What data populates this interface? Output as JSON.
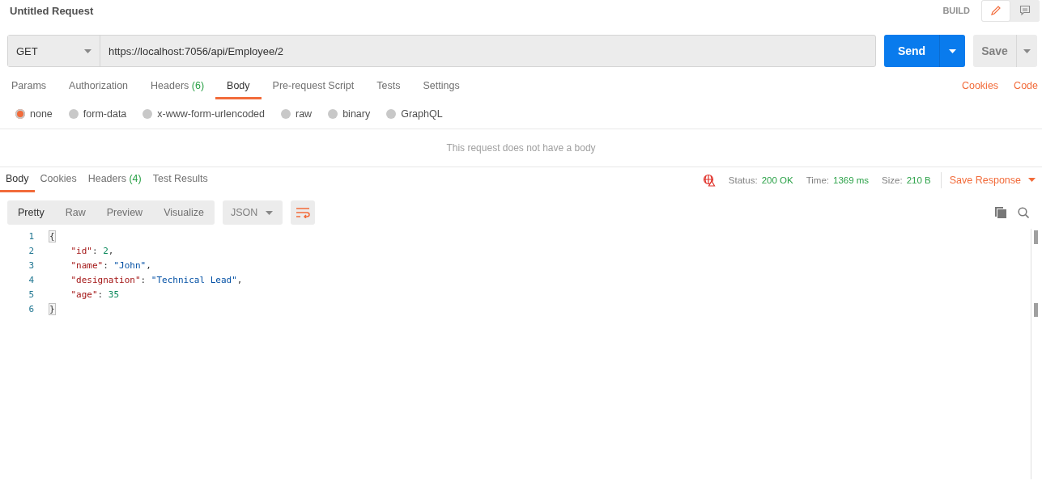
{
  "header": {
    "title": "Untitled Request",
    "mode": "BUILD",
    "mode_buttons": [
      {
        "kind": "edit",
        "selected": true
      },
      {
        "kind": "comments",
        "selected": false
      }
    ]
  },
  "request": {
    "method": "GET",
    "url": "https://localhost:7056/api/Employee/2",
    "send": "Send",
    "save": "Save"
  },
  "request_tabs": [
    {
      "label": "Params",
      "selected": false
    },
    {
      "label": "Authorization",
      "selected": false
    },
    {
      "label": "Headers",
      "count": "(6)",
      "selected": false
    },
    {
      "label": "Body",
      "selected": true
    },
    {
      "label": "Pre-request Script",
      "selected": false
    },
    {
      "label": "Tests",
      "selected": false
    },
    {
      "label": "Settings",
      "selected": false
    }
  ],
  "request_links": [
    "Cookies",
    "Code"
  ],
  "body_types": [
    {
      "label": "none",
      "selected": true
    },
    {
      "label": "form-data",
      "selected": false
    },
    {
      "label": "x-www-form-urlencoded",
      "selected": false
    },
    {
      "label": "raw",
      "selected": false
    },
    {
      "label": "binary",
      "selected": false
    },
    {
      "label": "GraphQL",
      "selected": false
    }
  ],
  "body_message": "This request does not have a body",
  "response_tabs": [
    {
      "label": "Body",
      "selected": true
    },
    {
      "label": "Cookies",
      "selected": false
    },
    {
      "label": "Headers",
      "count": "(4)",
      "selected": false
    },
    {
      "label": "Test Results",
      "selected": false
    }
  ],
  "response_meta": [
    {
      "label": "Status:",
      "value": "200 OK"
    },
    {
      "label": "Time:",
      "value": "1369 ms"
    },
    {
      "label": "Size:",
      "value": "210 B"
    }
  ],
  "save_response": "Save Response",
  "view_modes": [
    {
      "label": "Pretty",
      "selected": true
    },
    {
      "label": "Raw",
      "selected": false
    },
    {
      "label": "Preview",
      "selected": false
    },
    {
      "label": "Visualize",
      "selected": false
    }
  ],
  "format": "JSON",
  "code_lines": [
    {
      "number": "1",
      "tokens": [
        {
          "kind": "bracket",
          "text": "{"
        }
      ]
    },
    {
      "number": "2",
      "tokens": [
        {
          "kind": "key",
          "text": "    \"id\""
        },
        {
          "kind": "punct",
          "text": ": "
        },
        {
          "kind": "number",
          "text": "2"
        },
        {
          "kind": "punct",
          "text": ","
        }
      ]
    },
    {
      "number": "3",
      "tokens": [
        {
          "kind": "key",
          "text": "    \"name\""
        },
        {
          "kind": "punct",
          "text": ": "
        },
        {
          "kind": "string",
          "text": "\"John\""
        },
        {
          "kind": "punct",
          "text": ","
        }
      ]
    },
    {
      "number": "4",
      "tokens": [
        {
          "kind": "key",
          "text": "    \"designation\""
        },
        {
          "kind": "punct",
          "text": ": "
        },
        {
          "kind": "string",
          "text": "\"Technical Lead\""
        },
        {
          "kind": "punct",
          "text": ","
        }
      ]
    },
    {
      "number": "5",
      "tokens": [
        {
          "kind": "key",
          "text": "    \"age\""
        },
        {
          "kind": "punct",
          "text": ": "
        },
        {
          "kind": "number",
          "text": "35"
        }
      ]
    },
    {
      "number": "6",
      "tokens": [
        {
          "kind": "bracket",
          "text": "}"
        }
      ]
    }
  ]
}
